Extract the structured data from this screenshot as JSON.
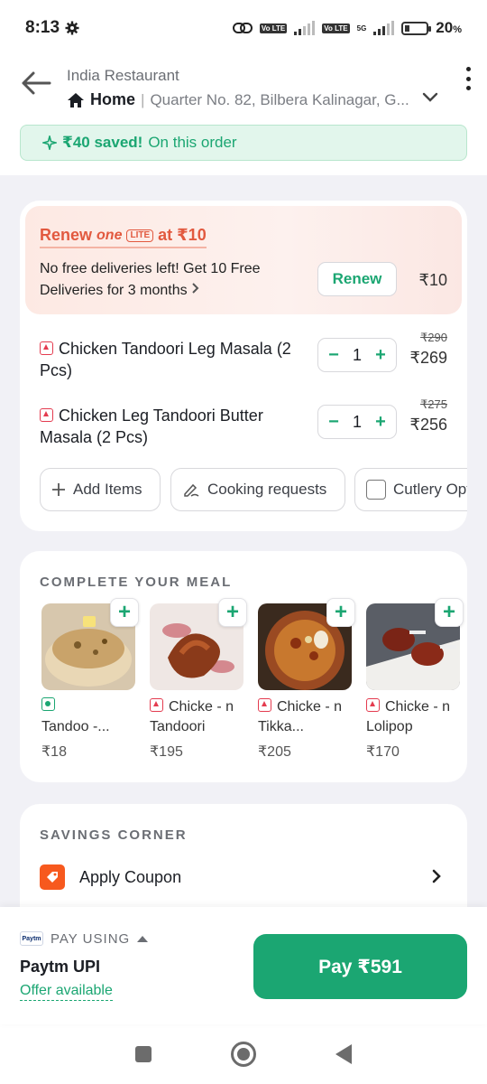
{
  "status_bar": {
    "time": "8:13",
    "battery": "20",
    "battery_unit": "%",
    "net_tags": [
      "Vo LTE",
      "Vo LTE"
    ],
    "net_5g": "5G"
  },
  "header": {
    "restaurant": "India Restaurant",
    "address_label": "Home",
    "address_separator": "|",
    "address": "Quarter No. 82, Bilbera Kalinagar, G..."
  },
  "savings_banner": {
    "icon": "sparkle-icon",
    "amount": "₹40 saved!",
    "text": "On this order"
  },
  "renew": {
    "title_prefix": "Renew",
    "brand": "one",
    "badge": "LITE",
    "title_suffix": "at ₹10",
    "description": "No free deliveries left! Get 10 Free Deliveries for 3 months",
    "button": "Renew",
    "price": "₹10"
  },
  "cart_items": [
    {
      "name": "Chicken Tandoori Leg Masala (2 Pcs)",
      "qty": "1",
      "old_price": "₹290",
      "price": "₹269"
    },
    {
      "name": "Chicken Leg Tandoori Butter Masala (2 Pcs)",
      "qty": "1",
      "old_price": "₹275",
      "price": "₹256"
    }
  ],
  "chips": {
    "add_items": "Add Items",
    "cooking_requests": "Cooking requests",
    "cutlery": "Cutlery Opt"
  },
  "complete_meal": {
    "title": "COMPLETE YOUR MEAL",
    "items": [
      {
        "name": "Tandoo -...",
        "price": "₹18",
        "veg": true
      },
      {
        "name": "Chicke - n Tandoori",
        "price": "₹195",
        "veg": false
      },
      {
        "name": "Chicke - n Tikka...",
        "price": "₹205",
        "veg": false
      },
      {
        "name": "Chicke - n Lolipop",
        "price": "₹170",
        "veg": false
      }
    ]
  },
  "savings_corner": {
    "title": "SAVINGS CORNER",
    "coupon": "Apply Coupon"
  },
  "pay_bar": {
    "paytm_logo_text": "Paytm",
    "pay_using": "PAY USING",
    "method": "Paytm UPI",
    "offer": "Offer available",
    "pay_button": "Pay ₹591"
  },
  "colors": {
    "accent": "#1ba672",
    "renew": "#e2593f",
    "nonveg": "#e43b4f",
    "coupon": "#f7591e"
  }
}
